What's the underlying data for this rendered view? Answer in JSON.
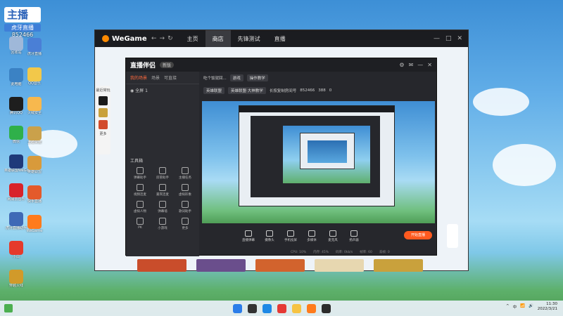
{
  "desktop": {
    "brand": {
      "logo": "主播",
      "label": "虎牙直播",
      "room_id": "852466"
    },
    "icons_col1": [
      {
        "label": "回收站",
        "color": "#9fb8d9"
      },
      {
        "label": "此电脑",
        "color": "#3b82c4"
      },
      {
        "label": "腾讯QQ",
        "color": "#1e1e1e"
      },
      {
        "label": "微信",
        "color": "#2fb04a"
      },
      {
        "label": "英雄联盟WeGame版",
        "color": "#1f3a7a"
      },
      {
        "label": "网易云音乐",
        "color": "#d8232a"
      },
      {
        "label": "虎牙直播助手",
        "color": "#3e69b6"
      },
      {
        "label": "小白",
        "color": "#e53a2b"
      },
      {
        "label": "穿越火线",
        "color": "#d19a2a"
      }
    ],
    "icons_col2": [
      {
        "label": "虎牙直播",
        "color": "#4a7fd6"
      },
      {
        "label": "QQ音乐",
        "color": "#f2c84a"
      },
      {
        "label": "火绒安全",
        "color": "#f7b84e"
      },
      {
        "label": "王者荣耀",
        "color": "#caa14b"
      },
      {
        "label": "英雄联盟",
        "color": "#d89a3b"
      },
      {
        "label": "快手直播",
        "color": "#e45a2b"
      },
      {
        "label": "WeGame",
        "color": "#ff7b1c"
      }
    ]
  },
  "wegame": {
    "logo": "WeGame",
    "nav_back": "←",
    "nav_forward": "→",
    "nav_refresh": "↻",
    "tabs": [
      {
        "label": "主页",
        "active": false
      },
      {
        "label": "商店",
        "active": true
      },
      {
        "label": "先锋测试",
        "active": false
      },
      {
        "label": "直播",
        "active": false
      }
    ],
    "window_controls": [
      "—",
      "□",
      "✕"
    ],
    "games_row": [
      {
        "name": "game-1",
        "color": "#c94d2b"
      },
      {
        "name": "game-2",
        "color": "#6a4e8c"
      },
      {
        "name": "game-3",
        "color": "#d2632d"
      },
      {
        "name": "game-4",
        "color": "#e7d7b0"
      },
      {
        "name": "game-5",
        "color": "#c9a13c"
      }
    ]
  },
  "zhibo": {
    "brand": "直播伴侣",
    "version_badge": "新版",
    "left_tabs": [
      "我的场景",
      "场景",
      "可直接"
    ],
    "active_left_tab": "我的场景",
    "scene_name": "全屏 1",
    "toolbox_title": "工具箱",
    "tools": [
      "弹幕助手",
      "房管助手",
      "主播任务",
      "视频连麦",
      "嘉宾连麦",
      "虚拟形象",
      "虚拟人物",
      "弹幕墙",
      "歌词助手",
      "PK",
      "小游戏",
      "更多"
    ],
    "rail_title": "最近常玩",
    "rail_more": "更多",
    "info": {
      "room_title": "吃个饭就回...",
      "category": "游戏",
      "edit_label": "操作教学",
      "tag1": "英雄联盟",
      "tag2": "英雄联盟·大神教学",
      "room_label": "长按复制房间号",
      "room_id": "852466",
      "viewers": "388",
      "likes": "0"
    },
    "controls": [
      "直播弹幕",
      "摄像头",
      "手机投屏",
      "多媒体",
      "麦克风",
      "扬声器"
    ],
    "start_button": "开始直播",
    "status": {
      "cpu": "CPU: 10%",
      "mem": "内存: 45%",
      "net": "码率: 0kb/s",
      "fps": "帧率: 60",
      "drop": "丢帧: 0"
    }
  },
  "taskbar": {
    "apps": [
      {
        "name": "start",
        "color": "#2b7de9"
      },
      {
        "name": "search",
        "color": "#333333"
      },
      {
        "name": "edge",
        "color": "#1e88e5"
      },
      {
        "name": "chrome",
        "color": "#e53935"
      },
      {
        "name": "explorer",
        "color": "#f6c343"
      },
      {
        "name": "store",
        "color": "#ff7b1c"
      },
      {
        "name": "wegame",
        "color": "#2b2b2b"
      }
    ],
    "tray_icons": [
      "^",
      "中",
      "📶",
      "🔊"
    ],
    "time": "11:30",
    "date": "2022/3/21"
  }
}
